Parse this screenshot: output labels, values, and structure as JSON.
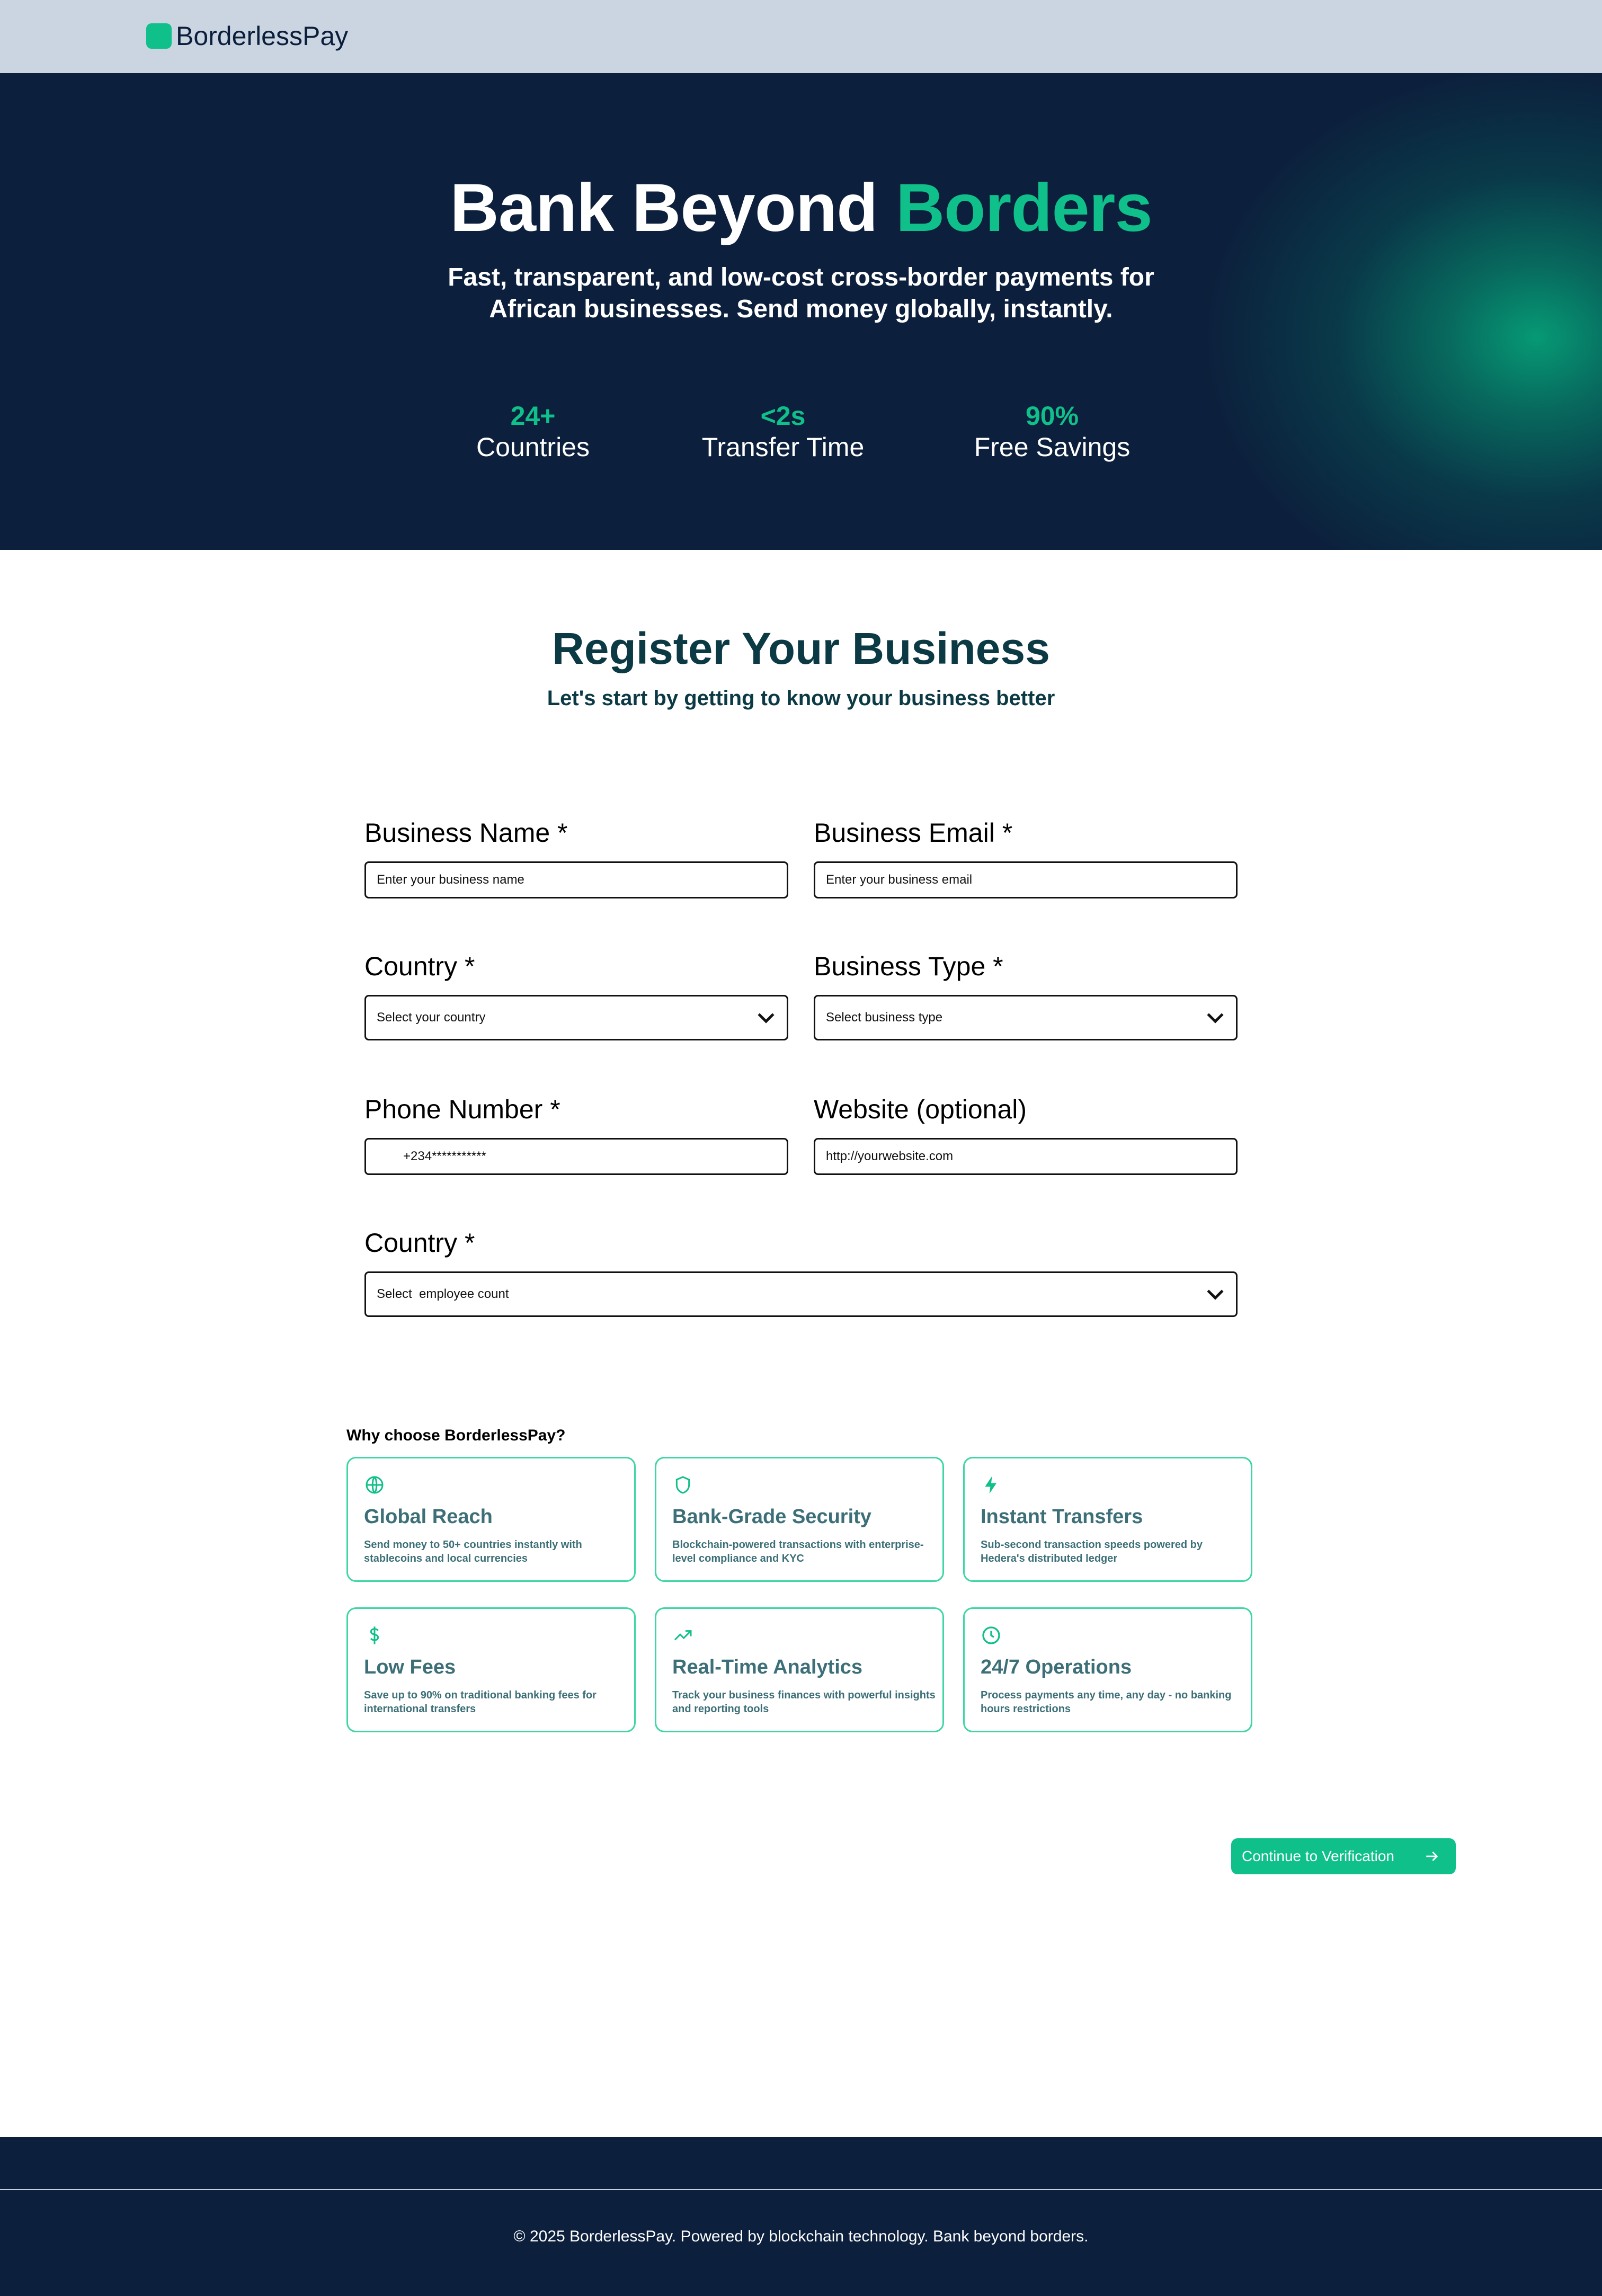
{
  "brand": {
    "name": "BorderlessPay",
    "accent_color": "#10c08a",
    "navy_color": "#0c1f3c"
  },
  "hero": {
    "title_main": "Bank Beyond ",
    "title_accent": "Borders",
    "subtitle": "Fast, transparent, and low-cost cross-border payments for African businesses. Send money globally, instantly.",
    "stats": [
      {
        "value": "24+",
        "label": "Countries"
      },
      {
        "value": "<2s",
        "label": "Transfer Time"
      },
      {
        "value": "90%",
        "label": "Free Savings"
      }
    ]
  },
  "register": {
    "title": "Register Your Business",
    "subtitle": "Let's start by getting to know your business better",
    "fields": {
      "business_name": {
        "label": "Business Name *",
        "placeholder": "Enter your business name"
      },
      "business_email": {
        "label": "Business Email *",
        "placeholder": "Enter your business email"
      },
      "country": {
        "label": "Country *",
        "selected": "Select your country"
      },
      "business_type": {
        "label": "Business Type *",
        "selected": "Select business type"
      },
      "phone": {
        "label": "Phone Number *",
        "value": "+234***********"
      },
      "website": {
        "label": "Website (optional)",
        "value": "http://yourwebsite.com"
      },
      "employee_count": {
        "label": "Country *",
        "selected": "Select  employee count"
      }
    }
  },
  "why": {
    "title": "Why choose BorderlessPay?",
    "cards": [
      {
        "icon": "globe-icon",
        "title": "Global Reach",
        "desc": "Send money to 50+ countries instantly with stablecoins and local currencies"
      },
      {
        "icon": "shield-icon",
        "title": "Bank-Grade Security",
        "desc": "Blockchain-powered transactions with enterprise-level compliance and KYC"
      },
      {
        "icon": "lightning-icon",
        "title": "Instant Transfers",
        "desc": "Sub-second transaction speeds powered by Hedera's distributed ledger"
      },
      {
        "icon": "dollar-icon",
        "title": "Low Fees",
        "desc": "Save up to 90% on traditional banking fees for international transfers"
      },
      {
        "icon": "trending-up-icon",
        "title": "Real-Time Analytics",
        "desc": "Track your business finances with powerful insights and reporting tools"
      },
      {
        "icon": "clock-icon",
        "title": "24/7 Operations",
        "desc": "Process payments any time, any day - no banking hours restrictions"
      }
    ]
  },
  "actions": {
    "continue_label": "Continue to Verification"
  },
  "footer": {
    "text": "© 2025 BorderlessPay. Powered by blockchain technology. Bank beyond borders."
  }
}
